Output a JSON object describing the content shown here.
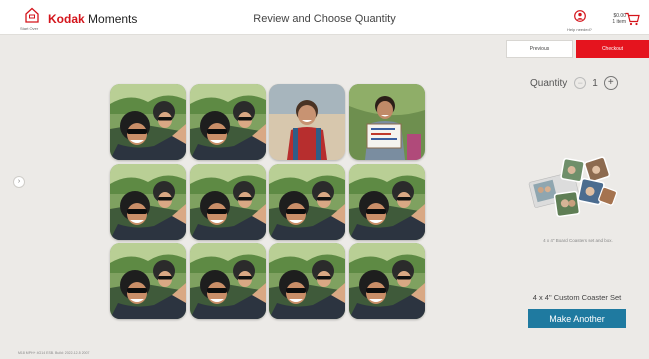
{
  "header": {
    "home_label": "Start Over",
    "brand_kodak": "Kodak",
    "brand_moments": " Moments",
    "title": "Review and Choose Quantity",
    "help_label": "Help needed?",
    "cart_price": "$0.00",
    "cart_items": "1 item"
  },
  "nav": {
    "previous": "Previous",
    "checkout": "Checkout"
  },
  "quantity": {
    "label": "Quantity",
    "minus": "−",
    "value": "1",
    "plus": "+"
  },
  "product": {
    "caption": "4 x 4\" Board Coasters set and box.",
    "set_title": "4 x 4\" Custom Coaster Set",
    "make_another": "Make Another"
  },
  "drawer_icon": "›",
  "footer": "M18 MPH+ 4G14 ESB. Build: 2022-12-5 2007",
  "photos": [
    "selfie",
    "selfie",
    "boy-backpack",
    "boy-sign",
    "selfie",
    "selfie",
    "selfie",
    "selfie",
    "selfie",
    "selfie",
    "selfie",
    "selfie"
  ],
  "colors": {
    "brand_red": "#d4141b",
    "checkout_red": "#e5141e",
    "make_another_blue": "#1f7aa0"
  }
}
